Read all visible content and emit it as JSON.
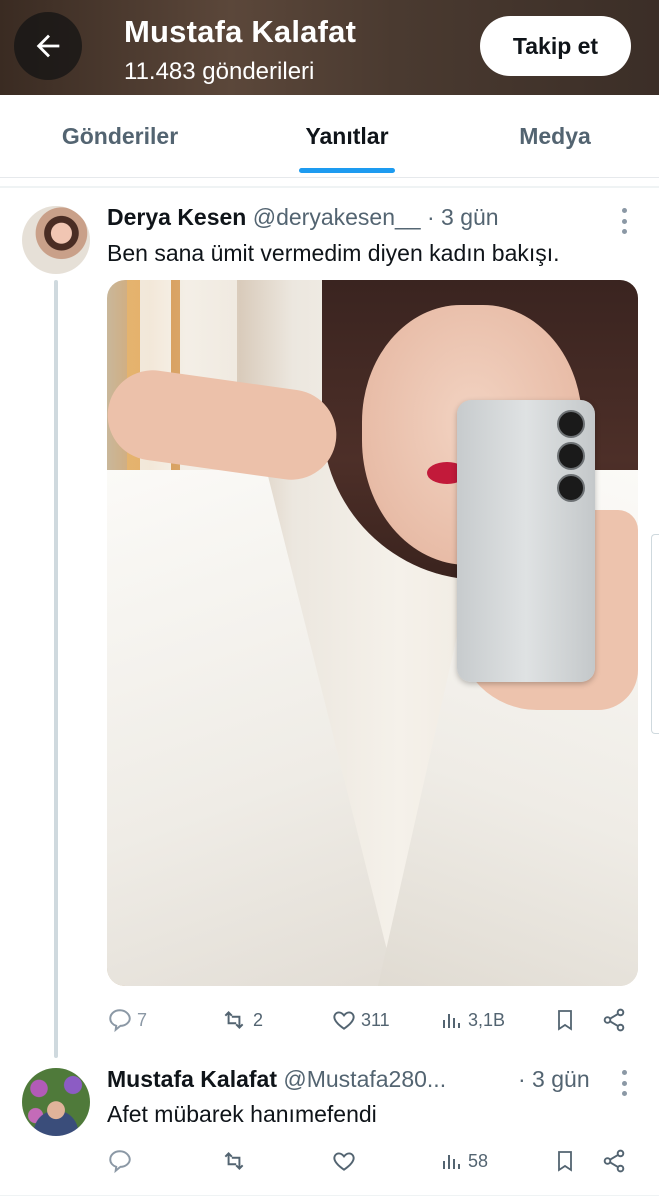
{
  "header": {
    "title": "Mustafa Kalafat",
    "post_count": "11.483 gönderileri",
    "follow_label": "Takip et"
  },
  "tabs": [
    {
      "label": "Gönderiler"
    },
    {
      "label": "Yanıtlar",
      "active": true
    },
    {
      "label": "Medya"
    }
  ],
  "tweets": [
    {
      "name": "Derya Kesen",
      "handle": "@deryakesen__",
      "time": "· 3 gün",
      "text": "Ben sana ümit vermedim diyen kadın bakışı.",
      "has_media": true,
      "replies": "7",
      "reposts": "2",
      "likes": "311",
      "views": "3,1B"
    },
    {
      "name": "Mustafa Kalafat",
      "handle": "@Mustafa280...",
      "time": "· 3 gün",
      "text": "Afet mübarek hanımefendi",
      "replies": "",
      "reposts": "",
      "likes": "",
      "views": "58"
    }
  ],
  "colors": {
    "accent": "#1d9bf0",
    "muted": "#536471",
    "text": "#0f1419"
  }
}
